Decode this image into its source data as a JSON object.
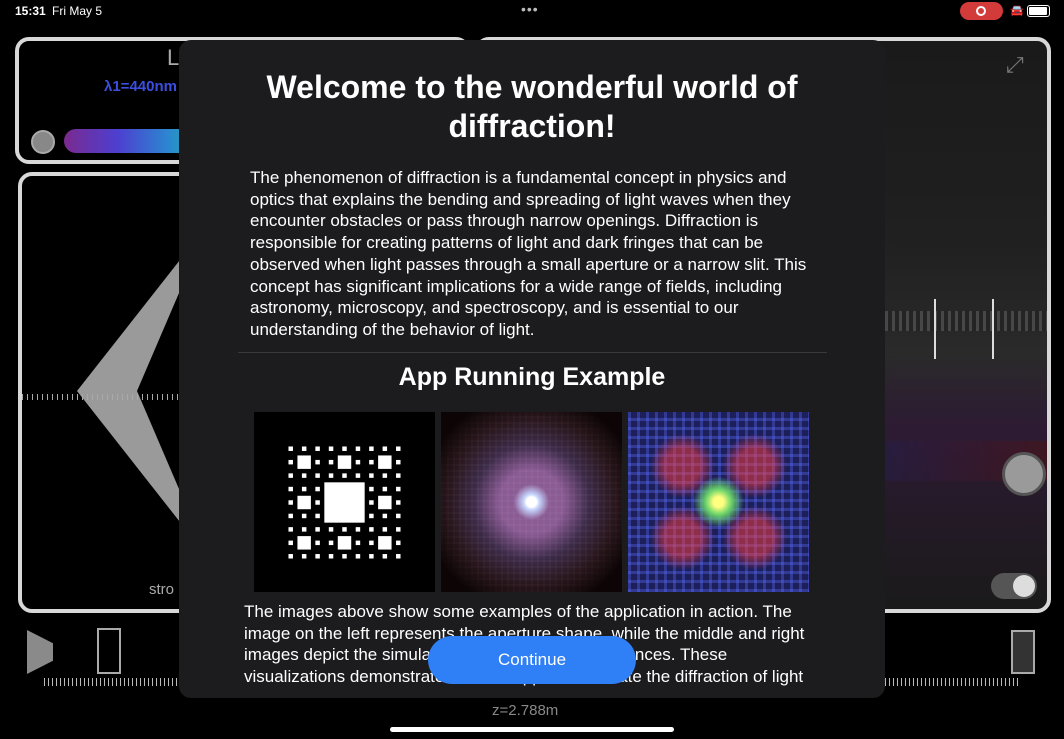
{
  "status_bar": {
    "time": "15:31",
    "date": "Fri May 5",
    "more_dots": "•••"
  },
  "background_app": {
    "top_left_title": "L",
    "wavelength_label": "λ1=440nm",
    "left_panel_label": "stro",
    "distance_label": "z=2.788m"
  },
  "modal": {
    "title": "Welcome to the wonderful world of diffraction!",
    "intro_paragraph": "The phenomenon of diffraction is a fundamental concept in physics and optics that explains the bending and spreading of light waves when they encounter obstacles or pass through narrow openings. Diffraction is responsible for creating patterns of light and dark fringes that can be observed when light passes through a small aperture or a narrow slit. This concept has significant implications for a wide range of fields, including astronomy, microscopy, and spectroscopy, and is essential to our understanding of the behavior of light.",
    "section_heading": "App Running Example",
    "outro_paragraph": "The images above show some examples of the application in action. The image on the left represents the aperture shape, while the middle and right images depict the simulated results at different distances. These visualizations demonstrate how the app can simulate the diffraction of light",
    "continue_label": "Continue"
  },
  "colors": {
    "accent": "#2f7ff6",
    "sheet_bg": "#1c1c1e",
    "recording": "#d33a3a"
  },
  "icons": [
    "expand-icon",
    "recording-indicator-icon",
    "battery-icon",
    "aperture-tool-icon"
  ]
}
